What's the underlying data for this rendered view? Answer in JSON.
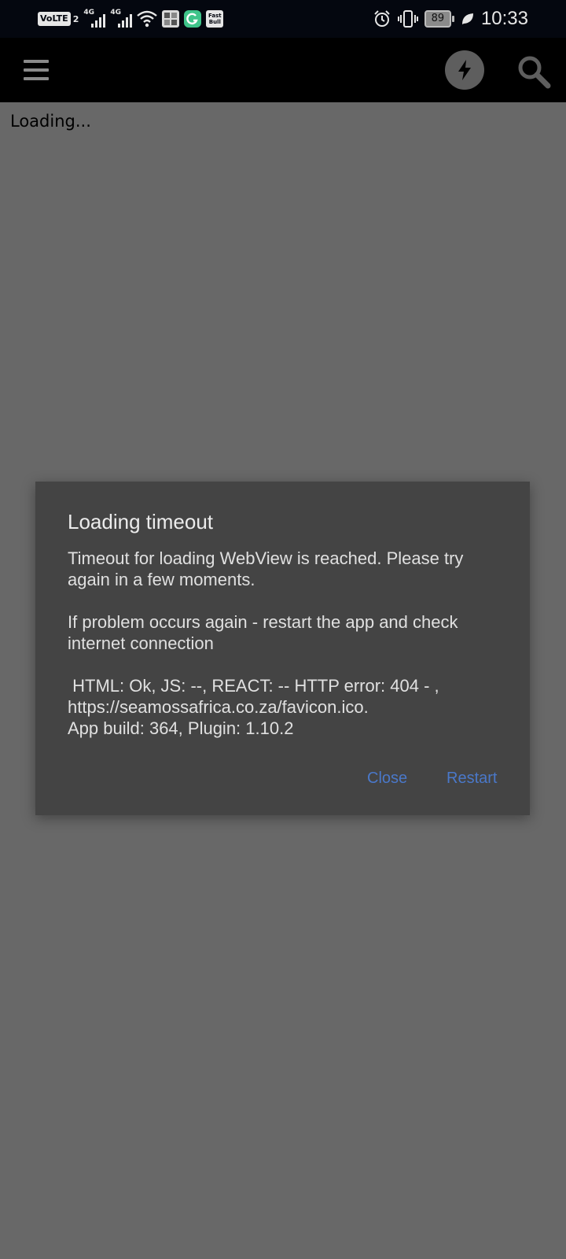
{
  "status_bar": {
    "volte": "VoLTE",
    "sim_number": "2",
    "net1": "4G",
    "net2": "4G",
    "app_icon_3": "Fast Bull",
    "battery": "89",
    "time": "10:33",
    "icons": [
      "volte-icon",
      "signal-icon",
      "signal-icon",
      "wifi-icon",
      "gallery-icon",
      "grammarly-icon",
      "fastbull-icon",
      "alarm-icon",
      "vibrate-icon",
      "battery-icon",
      "leaf-icon"
    ]
  },
  "toolbar": {
    "icons": [
      "menu-icon",
      "flash-icon",
      "search-icon"
    ]
  },
  "page": {
    "loading_text": "Loading..."
  },
  "dialog": {
    "title": "Loading timeout",
    "line1": "Timeout for loading WebView is reached. Please try again in a few moments.",
    "line2": "If problem occurs again - restart the app and check internet connection",
    "line3a": " HTML: Ok, JS: --, REACT: -- HTTP error: 404 - ,",
    "line3b": "https://seamossafrica.co.za/favicon.ico.",
    "line3c": "App build: 364, Plugin: 1.10.2",
    "close_label": "Close",
    "restart_label": "Restart",
    "accent_color": "#4a78c9"
  }
}
